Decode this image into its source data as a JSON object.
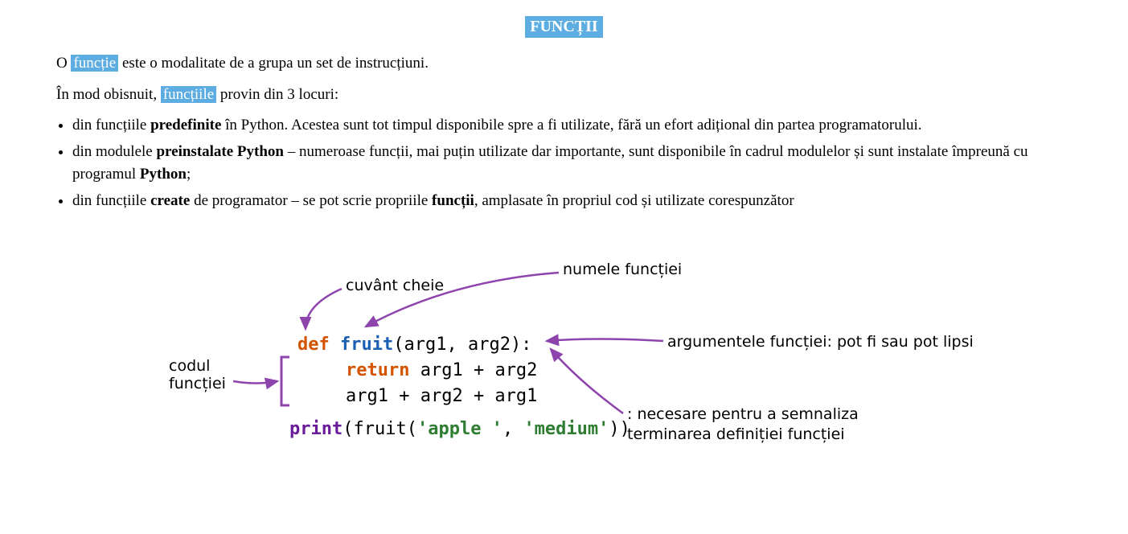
{
  "title": "FUNCȚII",
  "p1": {
    "pre": "O ",
    "hl": "funcție",
    "post": " este o modalitate de a grupa un set de instrucțiuni."
  },
  "p2": {
    "pre": "În mod obisnuit, ",
    "hl": "funcțiile",
    "post": " provin din 3 locuri:"
  },
  "bullets": {
    "b1": {
      "a": "din funcțiile ",
      "bold": "predefinite",
      "b": " în Python. Acestea sunt tot timpul disponibile spre a fi utilizate, fără un efort adițional din partea programatorului."
    },
    "b2": {
      "a": "din modulele ",
      "bold1": "preinstalate Python",
      "b": " – numeroase funcții, mai puțin utilizate dar importante, sunt disponibile în cadrul modulelor și sunt instalate împreună cu programul ",
      "bold2": "Python",
      "c": ";"
    },
    "b3": {
      "a": "din funcțiile ",
      "bold1": "create",
      "b": " de programator – se pot scrie propriile ",
      "bold2": "funcții",
      "c": ", amplasate în propriul cod și utilizate corespunzător"
    }
  },
  "diagram": {
    "labels": {
      "keyword": "cuvânt cheie",
      "funcname": "numele funcției",
      "funcbody": "codul\nfuncției",
      "args": "argumentele funcției: pot fi sau pot lipsi",
      "colon1": ": necesare pentru a semnaliza",
      "colon2": "terminarea definiției funcției"
    },
    "code": {
      "def": "def",
      "name": "fruit",
      "sig_open": "(",
      "sig_args": "arg1, arg2",
      "sig_close": "):",
      "return_kw": "return",
      "return_expr": " arg1 + arg2",
      "line3": "arg1 + arg2 + arg1",
      "print_kw": "print",
      "call_open": "(",
      "call_name": "fruit",
      "call_paren": "(",
      "str1": "'apple '",
      "comma": ", ",
      "str2": "'medium'",
      "call_close": "))"
    }
  }
}
